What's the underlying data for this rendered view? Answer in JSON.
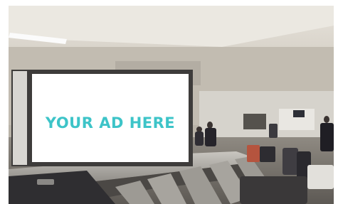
{
  "scene": {
    "description_free": true,
    "ad_text": "YOUR AD HERE",
    "ad_text_color": "#3dc4c8",
    "ad_background": "#ffffff"
  }
}
